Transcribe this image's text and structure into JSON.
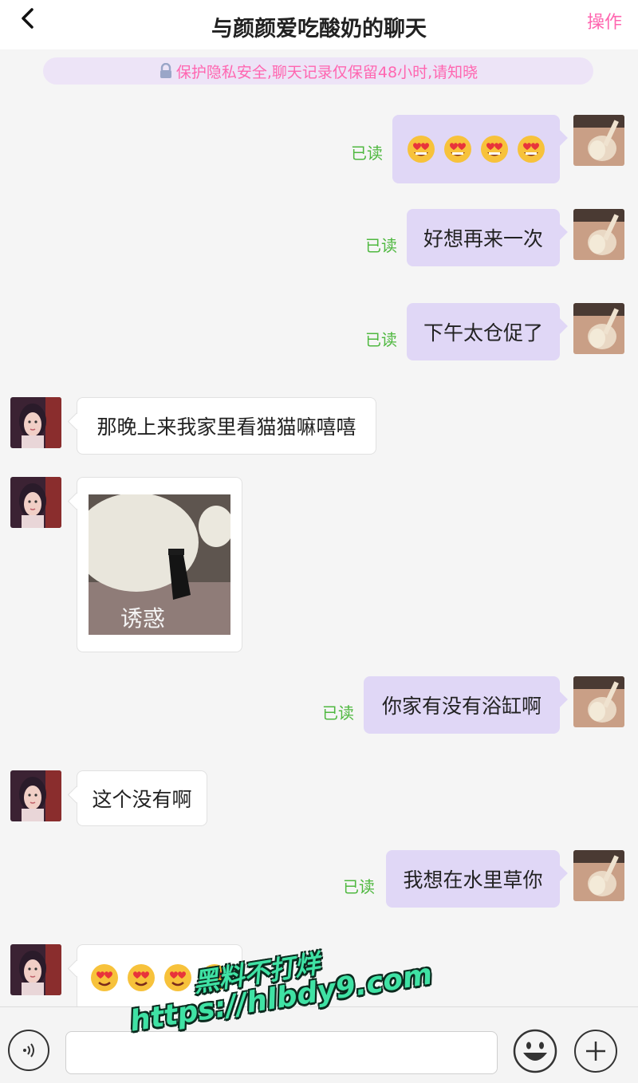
{
  "header": {
    "title": "与颜颜爱吃酸奶的聊天",
    "action_label": "操作"
  },
  "notice": {
    "text": "保护隐私安全,聊天记录仅保留48小时,请知晓"
  },
  "messages": [
    {
      "sender": "me",
      "type": "emoji",
      "content": "😍😍😍😍",
      "status": "已读"
    },
    {
      "sender": "me",
      "type": "text",
      "content": "好想再来一次",
      "status": "已读"
    },
    {
      "sender": "me",
      "type": "text",
      "content": "下午太仓促了",
      "status": "已读"
    },
    {
      "sender": "other",
      "type": "text",
      "content": "那晚上来我家里看猫猫嘛嘻嘻"
    },
    {
      "sender": "other",
      "type": "image",
      "caption": "诱惑"
    },
    {
      "sender": "me",
      "type": "text",
      "content": "你家有没有浴缸啊",
      "status": "已读"
    },
    {
      "sender": "other",
      "type": "text",
      "content": "这个没有啊"
    },
    {
      "sender": "me",
      "type": "text",
      "content": "我想在水里草你",
      "status": "已读"
    },
    {
      "sender": "other",
      "type": "emoji",
      "content": "😍😍😍😍"
    }
  ],
  "input": {
    "value": "",
    "placeholder": ""
  },
  "watermark": {
    "line1": "黑料不打烊",
    "line2": "https://hlbdy9.com"
  },
  "colors": {
    "accent": "#ff66b0",
    "my_bubble": "#e0d7f6",
    "read_status": "#4fb840",
    "notice_bg": "#ede4f7"
  }
}
